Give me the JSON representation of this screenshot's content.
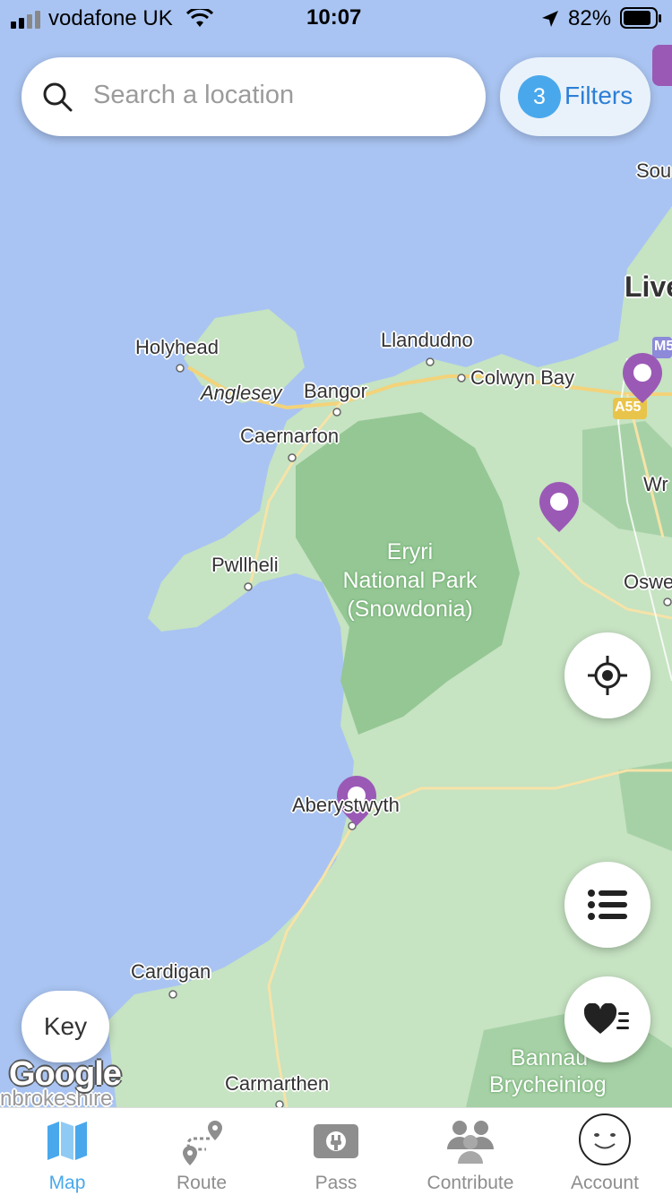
{
  "status_bar": {
    "carrier": "vodafone UK",
    "time": "10:07",
    "battery": "82%"
  },
  "search": {
    "placeholder": "Search a location"
  },
  "filters": {
    "count": "3",
    "label": "Filters"
  },
  "map": {
    "places": {
      "holyhead": "Holyhead",
      "anglesey": "Anglesey",
      "bangor": "Bangor",
      "llandudno": "Llandudno",
      "colwyn_bay": "Colwyn Bay",
      "caernarfon": "Caernarfon",
      "pwllheli": "Pwllheli",
      "park_line1": "Eryri",
      "park_line2": "National Park",
      "park_line3": "(Snowdonia)",
      "aberystwyth": "Aberystwyth",
      "cardigan": "Cardigan",
      "carmarthen": "Carmarthen",
      "bannau_1": "Bannau",
      "bannau_2": "Brycheiniog",
      "pembrokeshire": "nbrokeshire",
      "liverpool_partial": "Live",
      "southport_partial": "Sou",
      "wrexham_partial": "Wr",
      "oswestry_partial": "Oswe",
      "road_a55": "A55",
      "road_m5": "M5"
    },
    "attribution": "Google"
  },
  "key_button": "Key",
  "tabs": [
    {
      "label": "Map",
      "icon": "map-icon",
      "active": true
    },
    {
      "label": "Route",
      "icon": "route-icon",
      "active": false
    },
    {
      "label": "Pass",
      "icon": "pass-icon",
      "active": false
    },
    {
      "label": "Contribute",
      "icon": "contribute-icon",
      "active": false
    },
    {
      "label": "Account",
      "icon": "account-icon",
      "active": false
    }
  ],
  "colors": {
    "accent": "#49a8ec",
    "marker": "#9b59b6",
    "sea": "#a9c4f2",
    "land": "#c6e3c2",
    "park": "#94c794"
  }
}
